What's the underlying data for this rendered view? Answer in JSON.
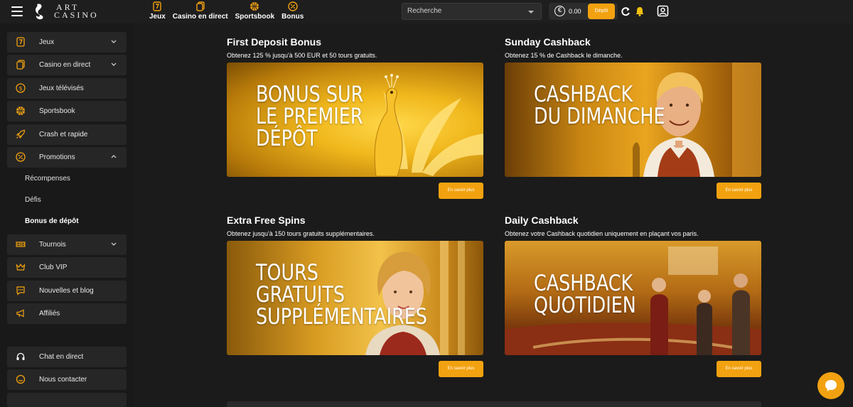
{
  "header": {
    "logo_line1": "ART",
    "logo_line2": "CASINO",
    "nav": [
      {
        "label": "Jeux",
        "icon": "seven-icon"
      },
      {
        "label": "Casino en direct",
        "icon": "cards-icon"
      },
      {
        "label": "Sportsbook",
        "icon": "basketball-icon"
      },
      {
        "label": "Bonus",
        "icon": "percent-badge-icon"
      }
    ],
    "search_placeholder": "Recherche",
    "balance": "0.00",
    "currency_symbol": "€",
    "deposit_label": "Dépôt"
  },
  "sidebar": {
    "items": [
      {
        "label": "Jeux",
        "icon": "seven-icon",
        "has_chevron": true
      },
      {
        "label": "Casino en direct",
        "icon": "cards-icon",
        "has_chevron": true
      },
      {
        "label": "Jeux télévisés",
        "icon": "dollar-coin-icon",
        "has_chevron": false
      },
      {
        "label": "Sportsbook",
        "icon": "basketball-icon",
        "has_chevron": false
      },
      {
        "label": "Crash et rapide",
        "icon": "rocket-icon",
        "has_chevron": false
      },
      {
        "label": "Promotions",
        "icon": "percent-badge-icon",
        "has_chevron": true,
        "expanded": true
      },
      {
        "label": "Tournois",
        "icon": "ticket-icon",
        "has_chevron": true
      },
      {
        "label": "Club VIP",
        "icon": "crown-icon",
        "has_chevron": false
      },
      {
        "label": "Nouvelles et blog",
        "icon": "chat-dots-icon",
        "has_chevron": false
      },
      {
        "label": "Affiliés",
        "icon": "megaphone-icon",
        "has_chevron": false
      }
    ],
    "promotions_sub": [
      "Récompenses",
      "Défis",
      "Bonus de dépôt"
    ],
    "active_sub": "Bonus de dépôt",
    "bottom_items": [
      {
        "label": "Chat en direct",
        "icon": "headset-icon"
      },
      {
        "label": "Nous contacter",
        "icon": "message-icon"
      }
    ]
  },
  "cards": [
    {
      "title": "First Deposit Bonus",
      "description": "Obtenez 125 % jusqu'à 500 EUR et 50 tours gratuits.",
      "banner_lines": [
        "BONUS SUR",
        "LE PREMIER",
        "DÉPÔT"
      ],
      "button": "En savoir plus"
    },
    {
      "title": "Sunday Cashback",
      "description": "Obtenez 15 % de Cashback le dimanche.",
      "banner_lines": [
        "CASHBACK",
        "DU DIMANCHE"
      ],
      "button": "En savoir plus"
    },
    {
      "title": "Extra Free Spins",
      "description": "Obtenez jusqu'à 150 tours gratuits supplémentaires.",
      "banner_lines": [
        "TOURS",
        "GRATUITS",
        "SUPPLÉMENTAIRES"
      ],
      "button": "En savoir plus"
    },
    {
      "title": "Daily Cashback",
      "description": "Obtenez votre Cashback quotidien uniquement en plaçant vos paris.",
      "banner_lines": [
        "CASHBACK",
        "QUOTIDIEN"
      ],
      "button": "En savoir plus"
    }
  ],
  "colors": {
    "accent": "#f2a210",
    "background": "#1b1b1b",
    "sidebar_item": "#262626"
  }
}
